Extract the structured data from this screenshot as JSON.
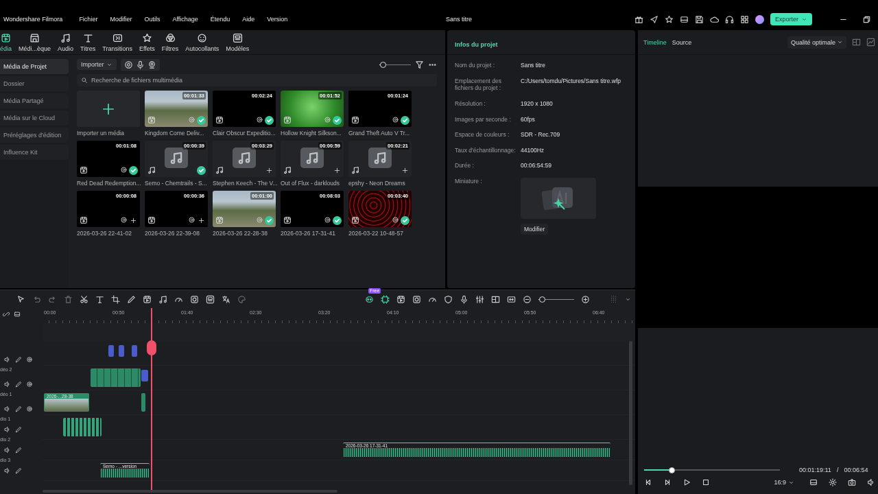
{
  "titlebar": {
    "app_name": "Wondershare Filmora",
    "menu": [
      "Fichier",
      "Modifier",
      "Outils",
      "Affichage",
      "Étendu",
      "Aide",
      "Version"
    ],
    "title": "Sans titre",
    "export_button": "Exporter"
  },
  "media_tabs": [
    {
      "label": "édia",
      "selected": true
    },
    {
      "label": "Médi...èque",
      "selected": false
    },
    {
      "label": "Audio",
      "selected": false
    },
    {
      "label": "Titres",
      "selected": false
    },
    {
      "label": "Transitions",
      "selected": false
    },
    {
      "label": "Effets",
      "selected": false
    },
    {
      "label": "Filtres",
      "selected": false
    },
    {
      "label": "Autocollants",
      "selected": false
    },
    {
      "label": "Modèles",
      "selected": false
    }
  ],
  "sidebar": {
    "items": [
      {
        "label": "Média de Projet",
        "selected": true
      },
      {
        "label": "Dossier",
        "selected": false
      },
      {
        "label": "Média Partagé",
        "selected": false
      },
      {
        "label": "Média sur le Cloud",
        "selected": false
      },
      {
        "label": "Préréglages d'édition",
        "selected": false
      },
      {
        "label": "Influence Kit",
        "selected": false
      }
    ]
  },
  "media": {
    "import_button": "Importer",
    "search": {
      "placeholder": "Recherche de fichiers multimédia"
    },
    "import_tile": "Importer un média",
    "items": [
      {
        "name": "Kingdom Come Deliv...",
        "duration": "00:01:33",
        "kind": "video",
        "used": true
      },
      {
        "name": "Clair Obscur Expeditio...",
        "duration": "00:02:24",
        "kind": "video",
        "used": true
      },
      {
        "name": "Hollow Knight Silkson...",
        "duration": "00:01:52",
        "kind": "video",
        "used": true
      },
      {
        "name": "Grand Theft Auto V Tr...",
        "duration": "00:01:24",
        "kind": "video",
        "used": true
      },
      {
        "name": "Red Dead Redemption...",
        "duration": "00:01:08",
        "kind": "video",
        "used": true
      },
      {
        "name": "Semo - Chemtrails - S...",
        "duration": "00:00:39",
        "kind": "audio",
        "used": true
      },
      {
        "name": "Stephen Keech - The V...",
        "duration": "00:03:29",
        "kind": "audio",
        "used": false
      },
      {
        "name": "Out of Flux - darklouds",
        "duration": "00:00:59",
        "kind": "audio",
        "used": false
      },
      {
        "name": "epshy - Neon Dreams",
        "duration": "00:02:21",
        "kind": "audio",
        "used": false
      },
      {
        "name": "2026-03-26 22-41-02",
        "duration": "00:00:08",
        "kind": "video",
        "used": false
      },
      {
        "name": "2026-03-26 22-39-08",
        "duration": "00:00:36",
        "kind": "video",
        "used": false
      },
      {
        "name": "2026-03-26 22-28-38",
        "duration": "00:01:00",
        "kind": "video",
        "used": true
      },
      {
        "name": "2026-03-26 17-31-41",
        "duration": "00:08:03",
        "kind": "video",
        "used": true
      },
      {
        "name": "2026-03-22 10-48-57",
        "duration": "00:03:40",
        "kind": "video",
        "used": true
      }
    ],
    "thumb_size": {
      "level": 0.1
    }
  },
  "project_info": {
    "title": "Infos du projet",
    "rows": [
      {
        "label": "Nom du projet :",
        "value": "Sans titre"
      },
      {
        "label": "Emplacement des fichiers du projet :",
        "value": "C:/Users/tomdu/Pictures/Sans titre.wfp"
      },
      {
        "label": "Résolution :",
        "value": "1920 x 1080"
      },
      {
        "label": "Images par seconde :",
        "value": "60fps"
      },
      {
        "label": "Espace de couleurs :",
        "value": "SDR - Rec.709"
      },
      {
        "label": "Taux d'échantillonnage:",
        "value": "44100Hz"
      },
      {
        "label": "Durée :",
        "value": "00:06:54:59"
      }
    ],
    "thumbnail_label": "Miniature :",
    "edit_button": "Modifier"
  },
  "preview": {
    "tabs": [
      {
        "label": "Timeline",
        "selected": true
      },
      {
        "label": "Source",
        "selected": false
      }
    ],
    "quality": "Qualité optimale",
    "progress": {
      "level": 0.2
    },
    "current_time": "00:01:19:11",
    "separator": "/",
    "total_time": "00:06:54",
    "aspect": "16:9"
  },
  "timeline": {
    "toolbar_badge": "Free",
    "zoom": {
      "level": 0.1
    },
    "ruler": [
      "00:00",
      "00:50",
      "01:40",
      "02:30",
      "03:20",
      "04:10",
      "05:00",
      "05:50",
      "06:40"
    ],
    "tracks": [
      {
        "kind": "video"
      },
      {
        "label": "déo 2",
        "kind": "video"
      },
      {
        "label": "déo 1",
        "kind": "video",
        "clips": [
          {
            "label": "2026-...28-38",
            "kind": "video"
          }
        ]
      },
      {
        "label": "dio 1",
        "kind": "audio"
      },
      {
        "label": "dio 2",
        "kind": "audio",
        "clips": [
          {
            "label": "2026-03-26 17-31-41",
            "kind": "audio"
          }
        ]
      },
      {
        "label": "dio 3",
        "kind": "audio",
        "clips": [
          {
            "label": "Semo - ...version",
            "kind": "audio"
          }
        ]
      }
    ]
  }
}
